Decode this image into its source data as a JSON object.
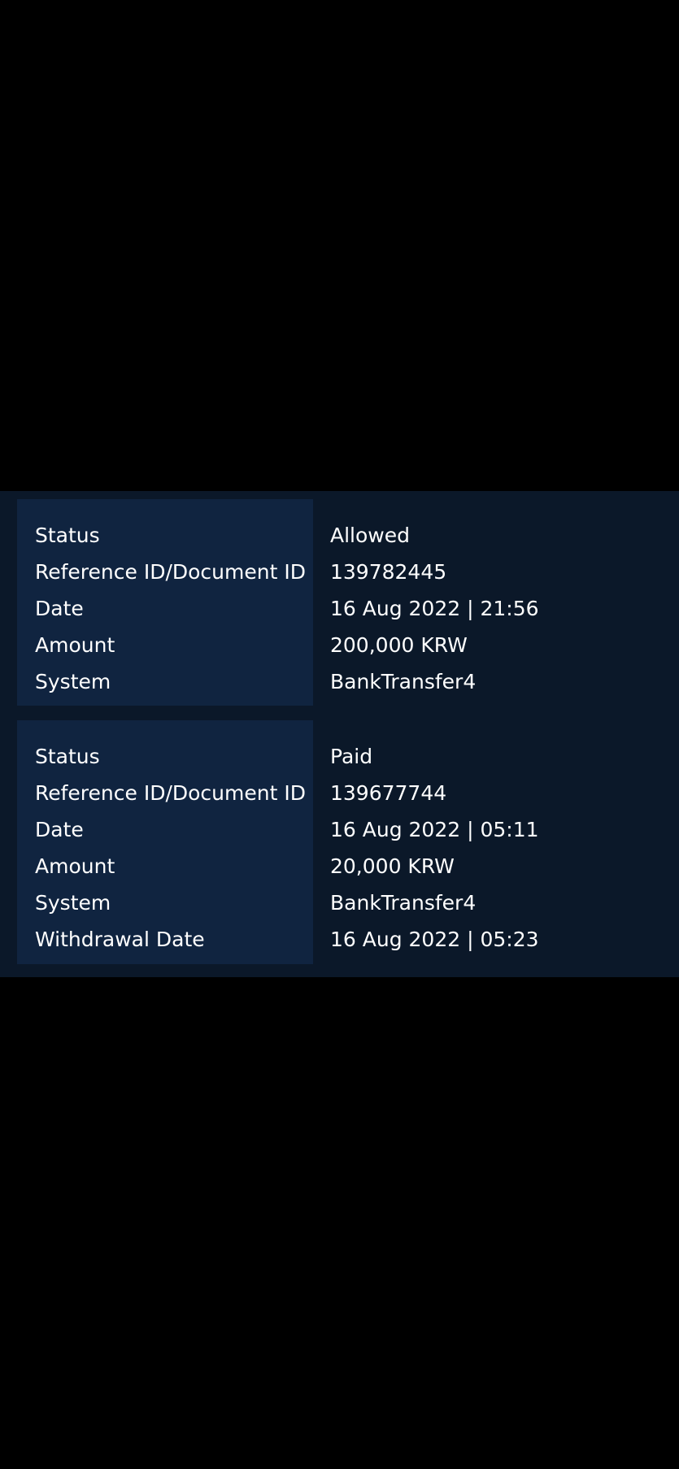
{
  "transactions": [
    {
      "rows": [
        {
          "label": "Status",
          "value": "Allowed"
        },
        {
          "label": "Reference ID/Document ID",
          "value": "139782445"
        },
        {
          "label": "Date",
          "value": "16 Aug 2022 | 21:56"
        },
        {
          "label": "Amount",
          "value": "200,000 KRW"
        },
        {
          "label": "System",
          "value": "BankTransfer4"
        }
      ]
    },
    {
      "rows": [
        {
          "label": "Status",
          "value": "Paid"
        },
        {
          "label": "Reference ID/Document ID",
          "value": "139677744"
        },
        {
          "label": "Date",
          "value": "16 Aug 2022 | 05:11"
        },
        {
          "label": "Amount",
          "value": "20,000 KRW"
        },
        {
          "label": "System",
          "value": "BankTransfer4"
        },
        {
          "label": "Withdrawal Date",
          "value": "16 Aug 2022 | 05:23"
        }
      ]
    }
  ]
}
